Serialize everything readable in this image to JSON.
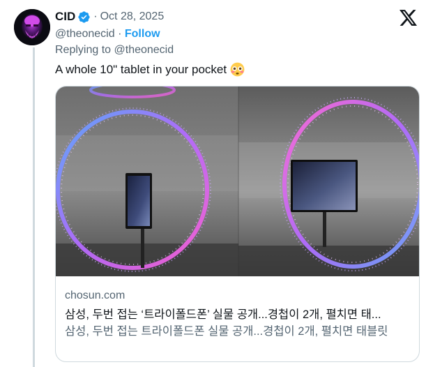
{
  "tweet": {
    "author_name": "CID",
    "verified_icon": "verified-badge-icon",
    "separator": "·",
    "date": "Oct 28, 2025",
    "handle": "@theonecid",
    "follow_label": "Follow",
    "reply_prefix": "Replying to",
    "reply_to_handle": "@theonecid",
    "text": "A whole 10\" tablet in your pocket",
    "text_emoji": "flushed-face-emoji"
  },
  "card": {
    "domain": "chosun.com",
    "title": "삼성, 두번 접는 ‘트라이폴드폰’ 실물 공개...경첩이 2개, 펼치면 태...",
    "description": "삼성, 두번 접는 트라이폴드폰 실물 공개...경첩이 2개, 펼치면 태블릿"
  },
  "colors": {
    "link": "#1d9bf0",
    "secondary_text": "#536471",
    "primary_text": "#0f1419",
    "border": "#cfd9de"
  }
}
